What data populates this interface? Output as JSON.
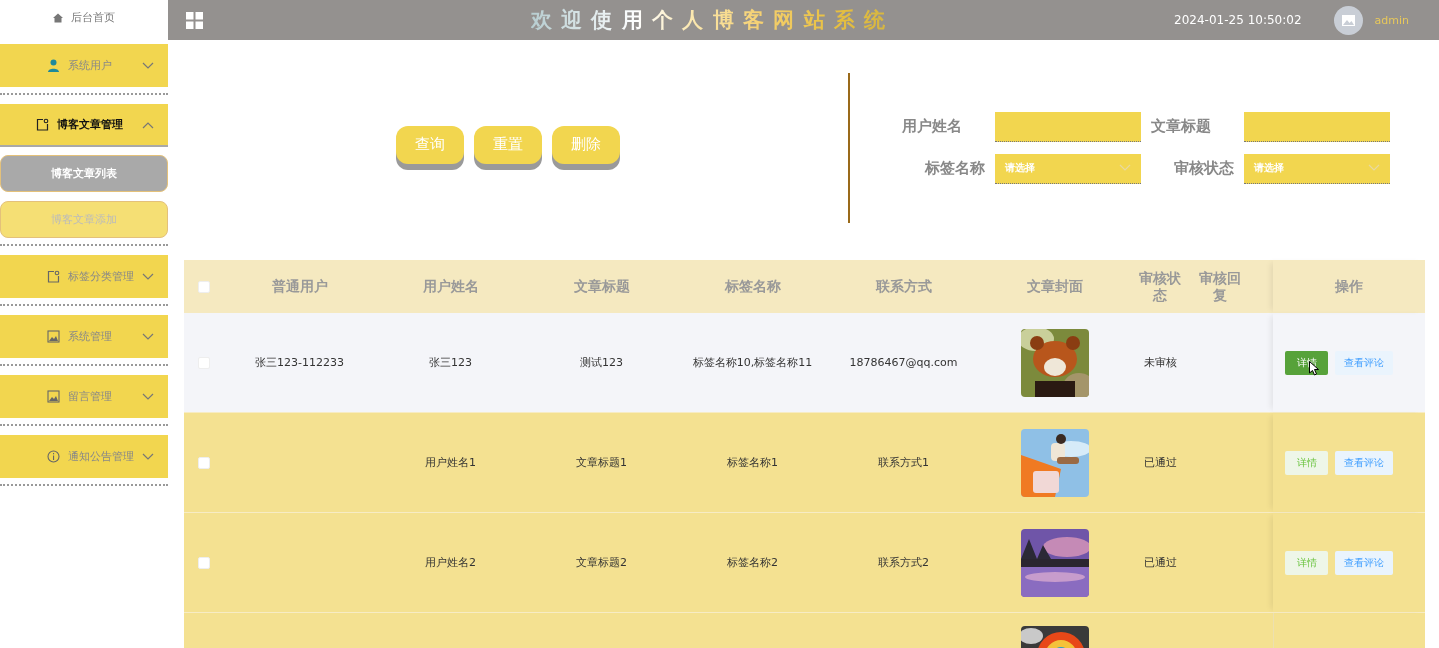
{
  "sidebar": {
    "home": {
      "label": "后台首页"
    },
    "menus": [
      {
        "label": "系统用户",
        "expanded": false
      },
      {
        "label": "博客文章管理",
        "expanded": true,
        "children": [
          {
            "label": "博客文章列表",
            "selected": true
          },
          {
            "label": "博客文章添加",
            "selected": false
          }
        ]
      },
      {
        "label": "标签分类管理",
        "expanded": false
      },
      {
        "label": "系统管理",
        "expanded": false
      },
      {
        "label": "留言管理",
        "expanded": false
      },
      {
        "label": "通知公告管理",
        "expanded": false
      }
    ]
  },
  "header": {
    "title": "欢 迎 使 用 个 人 博 客 网 站 系 统",
    "datetime": "2024-01-25 10:50:02",
    "username": "admin"
  },
  "search": {
    "buttons": [
      {
        "label": "查询"
      },
      {
        "label": "重置"
      },
      {
        "label": "删除"
      }
    ],
    "fields": [
      {
        "label": "用户姓名",
        "kind": "input"
      },
      {
        "label": "文章标题",
        "kind": "input"
      },
      {
        "label": "标签名称",
        "kind": "select",
        "placeholder": "请选择"
      },
      {
        "label": "审核状态",
        "kind": "select",
        "placeholder": "请选择"
      }
    ]
  },
  "table": {
    "columns": [
      "普通用户",
      "用户姓名",
      "文章标题",
      "标签名称",
      "联系方式",
      "文章封面",
      "审核状态",
      "审核回复",
      "操作"
    ],
    "header_checked": false,
    "rows": [
      {
        "highlighted": true,
        "checked": false,
        "cells": [
          "张三123-112233",
          "张三123",
          "测试123",
          "标签名称10,标签名称11",
          "18786467@qq.com"
        ],
        "status": "未审核",
        "actions": [
          {
            "label": "详情",
            "kind": "detail",
            "hovered": true
          },
          {
            "label": "查看评论",
            "kind": "comments",
            "hovered": false
          }
        ]
      },
      {
        "highlighted": false,
        "checked": false,
        "cells": [
          "",
          "用户姓名1",
          "文章标题1",
          "标签名称1",
          "联系方式1"
        ],
        "status": "已通过",
        "actions": [
          {
            "label": "详情",
            "kind": "detail",
            "hovered": false
          },
          {
            "label": "查看评论",
            "kind": "comments",
            "hovered": false
          }
        ]
      },
      {
        "highlighted": false,
        "checked": false,
        "cells": [
          "",
          "用户姓名2",
          "文章标题2",
          "标签名称2",
          "联系方式2"
        ],
        "status": "已通过",
        "actions": [
          {
            "label": "详情",
            "kind": "detail",
            "hovered": false
          },
          {
            "label": "查看评论",
            "kind": "comments",
            "hovered": false
          }
        ]
      },
      {
        "kind": "partial"
      }
    ]
  }
}
